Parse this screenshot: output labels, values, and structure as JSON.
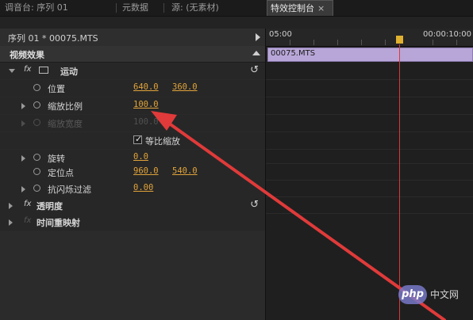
{
  "tabs": [
    {
      "label": "调音台: 序列 01",
      "active": false
    },
    {
      "label": "元数据",
      "active": false
    },
    {
      "label": "源: (无素材)",
      "active": false
    },
    {
      "label": "特效控制台",
      "active": true,
      "close": "×"
    }
  ],
  "sequence_header": {
    "label": "序列 01 * 00075.MTS"
  },
  "section": {
    "label": "视频效果"
  },
  "effects": {
    "motion": {
      "fx": "fx",
      "label": "运动"
    },
    "position": {
      "label": "位置",
      "x": "640.0",
      "y": "360.0"
    },
    "scale": {
      "label": "缩放比例",
      "value": "100.0"
    },
    "scale_width": {
      "label": "缩放宽度",
      "value": "100.0"
    },
    "uniform_scale": {
      "label": "等比缩放",
      "checked": true,
      "mark": "✓"
    },
    "rotation": {
      "label": "旋转",
      "value": "0.0"
    },
    "anchor": {
      "label": "定位点",
      "x": "960.0",
      "y": "540.0"
    },
    "antiflicker": {
      "label": "抗闪烁过滤",
      "value": "0.00"
    },
    "opacity": {
      "fx": "fx",
      "label": "透明度"
    },
    "time_remap": {
      "fx": "fx",
      "label": "时间重映射"
    }
  },
  "timeline": {
    "start": "05:00",
    "end": "00:00:10:00",
    "clip": "00075.MTS"
  },
  "watermark": {
    "brand": "php",
    "site": "中文网"
  },
  "colors": {
    "accent_value": "#e0a33a",
    "clip": "#b8a6d8",
    "playhead": "#d83a3a",
    "arrow": "#e03a3a"
  }
}
